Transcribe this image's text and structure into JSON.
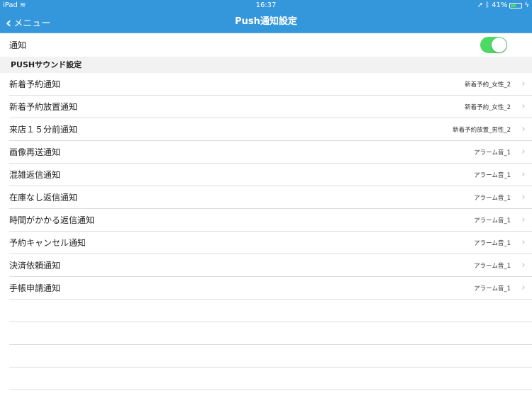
{
  "status": {
    "device": "iPad",
    "time": "16:37",
    "battery": "41%",
    "battery_level": 0.41
  },
  "nav": {
    "back_label": "メニュー",
    "title": "Push通知設定"
  },
  "notification": {
    "label": "通知",
    "enabled": true
  },
  "section": {
    "title": "PUSHサウンド設定"
  },
  "rows": [
    {
      "label": "新着予約通知",
      "value": "新着予約_女性_2"
    },
    {
      "label": "新着予約放置通知",
      "value": "新着予約_女性_2"
    },
    {
      "label": "来店１５分前通知",
      "value": "新着予約放置_男性_2"
    },
    {
      "label": "画像再送通知",
      "value": "アラーム音_1"
    },
    {
      "label": "混雑返信通知",
      "value": "アラーム音_1"
    },
    {
      "label": "在庫なし返信通知",
      "value": "アラーム音_1"
    },
    {
      "label": "時間がかかる返信通知",
      "value": "アラーム音_1"
    },
    {
      "label": "予約キャンセル通知",
      "value": "アラーム音_1"
    },
    {
      "label": "決済依頼通知",
      "value": "アラーム音_1"
    },
    {
      "label": "手帳申請通知",
      "value": "アラーム音_1"
    }
  ]
}
